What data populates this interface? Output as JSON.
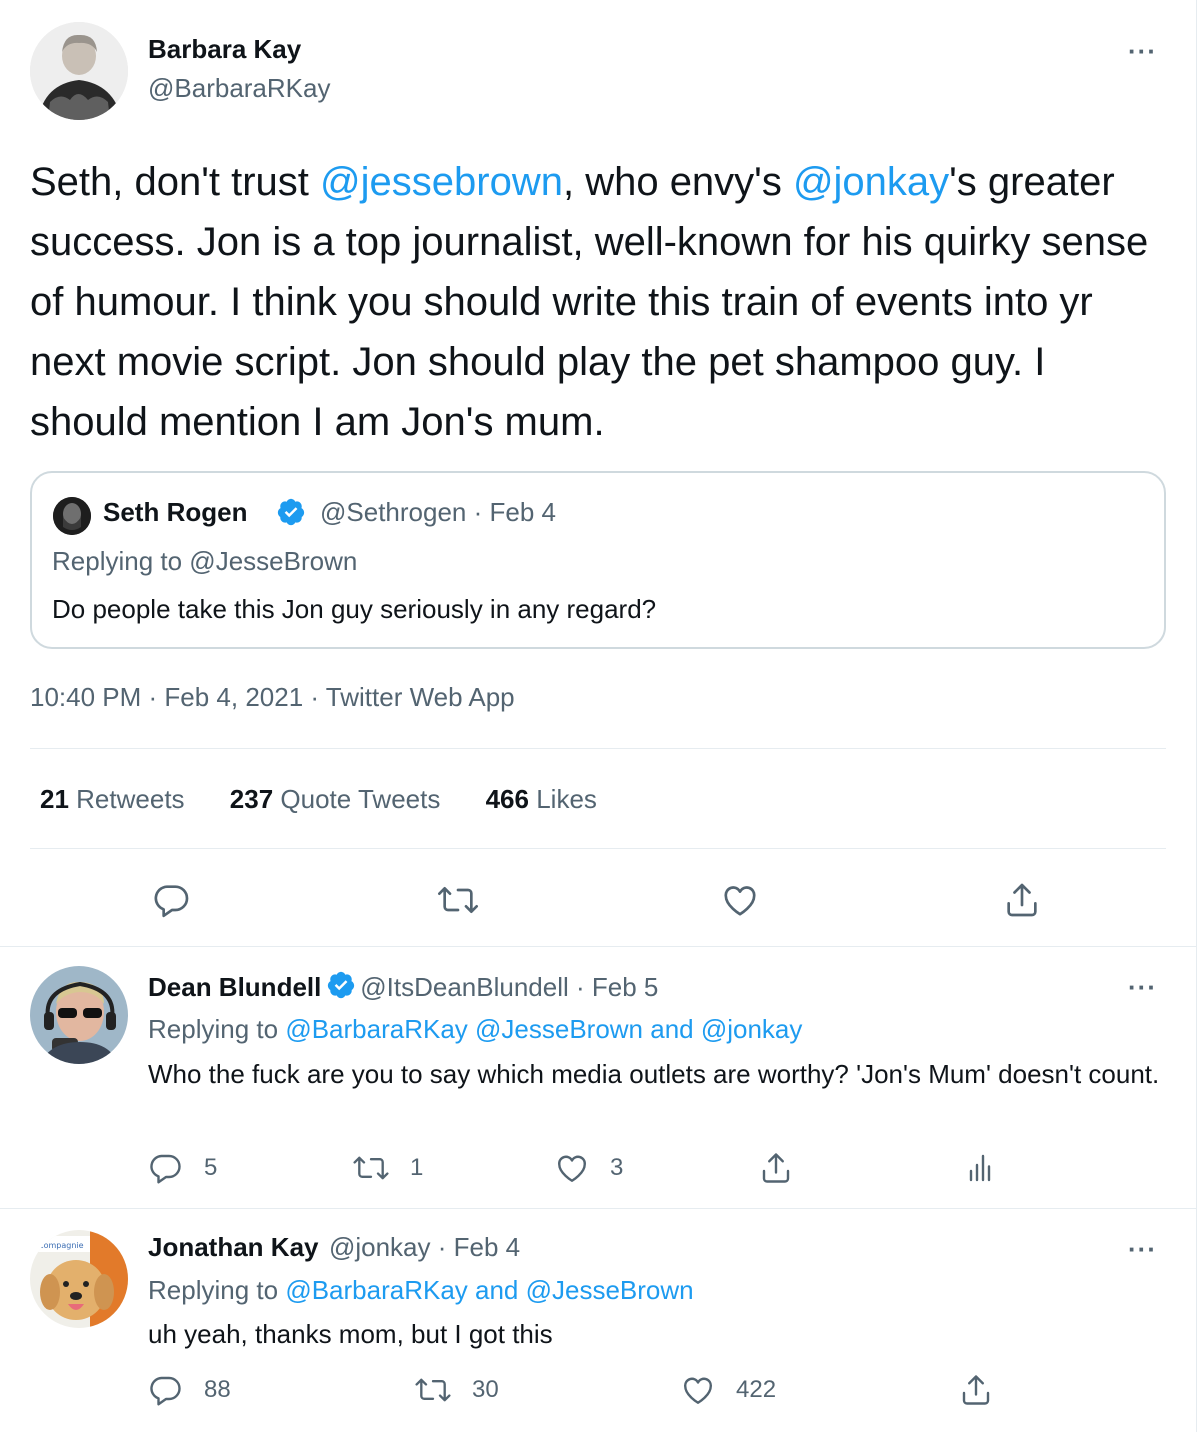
{
  "main_tweet": {
    "author_name": "Barbara Kay",
    "author_handle": "@BarbaraRKay",
    "more": "···",
    "text_parts": {
      "p1": "Seth, don't trust ",
      "m1": "@jessebrown",
      "p2": ", who envy's ",
      "m2": "@jonkay",
      "p3": "'s greater success. Jon is a top journalist, well-known for his quirky sense of humour. I think you should write this train of events into yr next movie script. Jon should play the pet shampoo guy. I should mention I am Jon's mum."
    },
    "quoted": {
      "author_name": "Seth Rogen",
      "verified": true,
      "handle_date": "@Sethrogen · Feb 4",
      "replying_to": "Replying to @JesseBrown",
      "text": "Do people take this Jon guy seriously in any regard?"
    },
    "timestamp": "10:40 PM · Feb 4, 2021 · Twitter Web App",
    "stats": {
      "retweets_count": "21",
      "retweets_label": "Retweets",
      "quotes_count": "237",
      "quotes_label": "Quote Tweets",
      "likes_count": "466",
      "likes_label": "Likes"
    },
    "actions": [
      "reply-icon",
      "retweet-icon",
      "like-icon",
      "share-icon"
    ]
  },
  "replies": [
    {
      "author_name": "Dean Blundell",
      "verified": true,
      "handle_date": "@ItsDeanBlundell · Feb 5",
      "replying_label": "Replying to ",
      "replying_to": "@BarbaraRKay @JesseBrown and @jonkay",
      "text": "Who the fuck are you to say which media outlets are worthy?  'Jon's Mum' doesn't count.",
      "reply_count": "5",
      "retweet_count": "1",
      "like_count": "3",
      "more": "···"
    },
    {
      "author_name": "Jonathan Kay",
      "verified": false,
      "handle_date": "@jonkay · Feb 4",
      "replying_label": "Replying to ",
      "replying_to": "@BarbaraRKay and @JesseBrown",
      "text": "uh yeah, thanks mom, but I got this",
      "reply_count": "88",
      "retweet_count": "30",
      "like_count": "422",
      "more": "···"
    }
  ],
  "colors": {
    "link": "#1d9bf0",
    "secondary_text": "#536471",
    "primary_text": "#0f1419",
    "divider": "#e6ecf0",
    "verified": "#1d9bf0"
  }
}
